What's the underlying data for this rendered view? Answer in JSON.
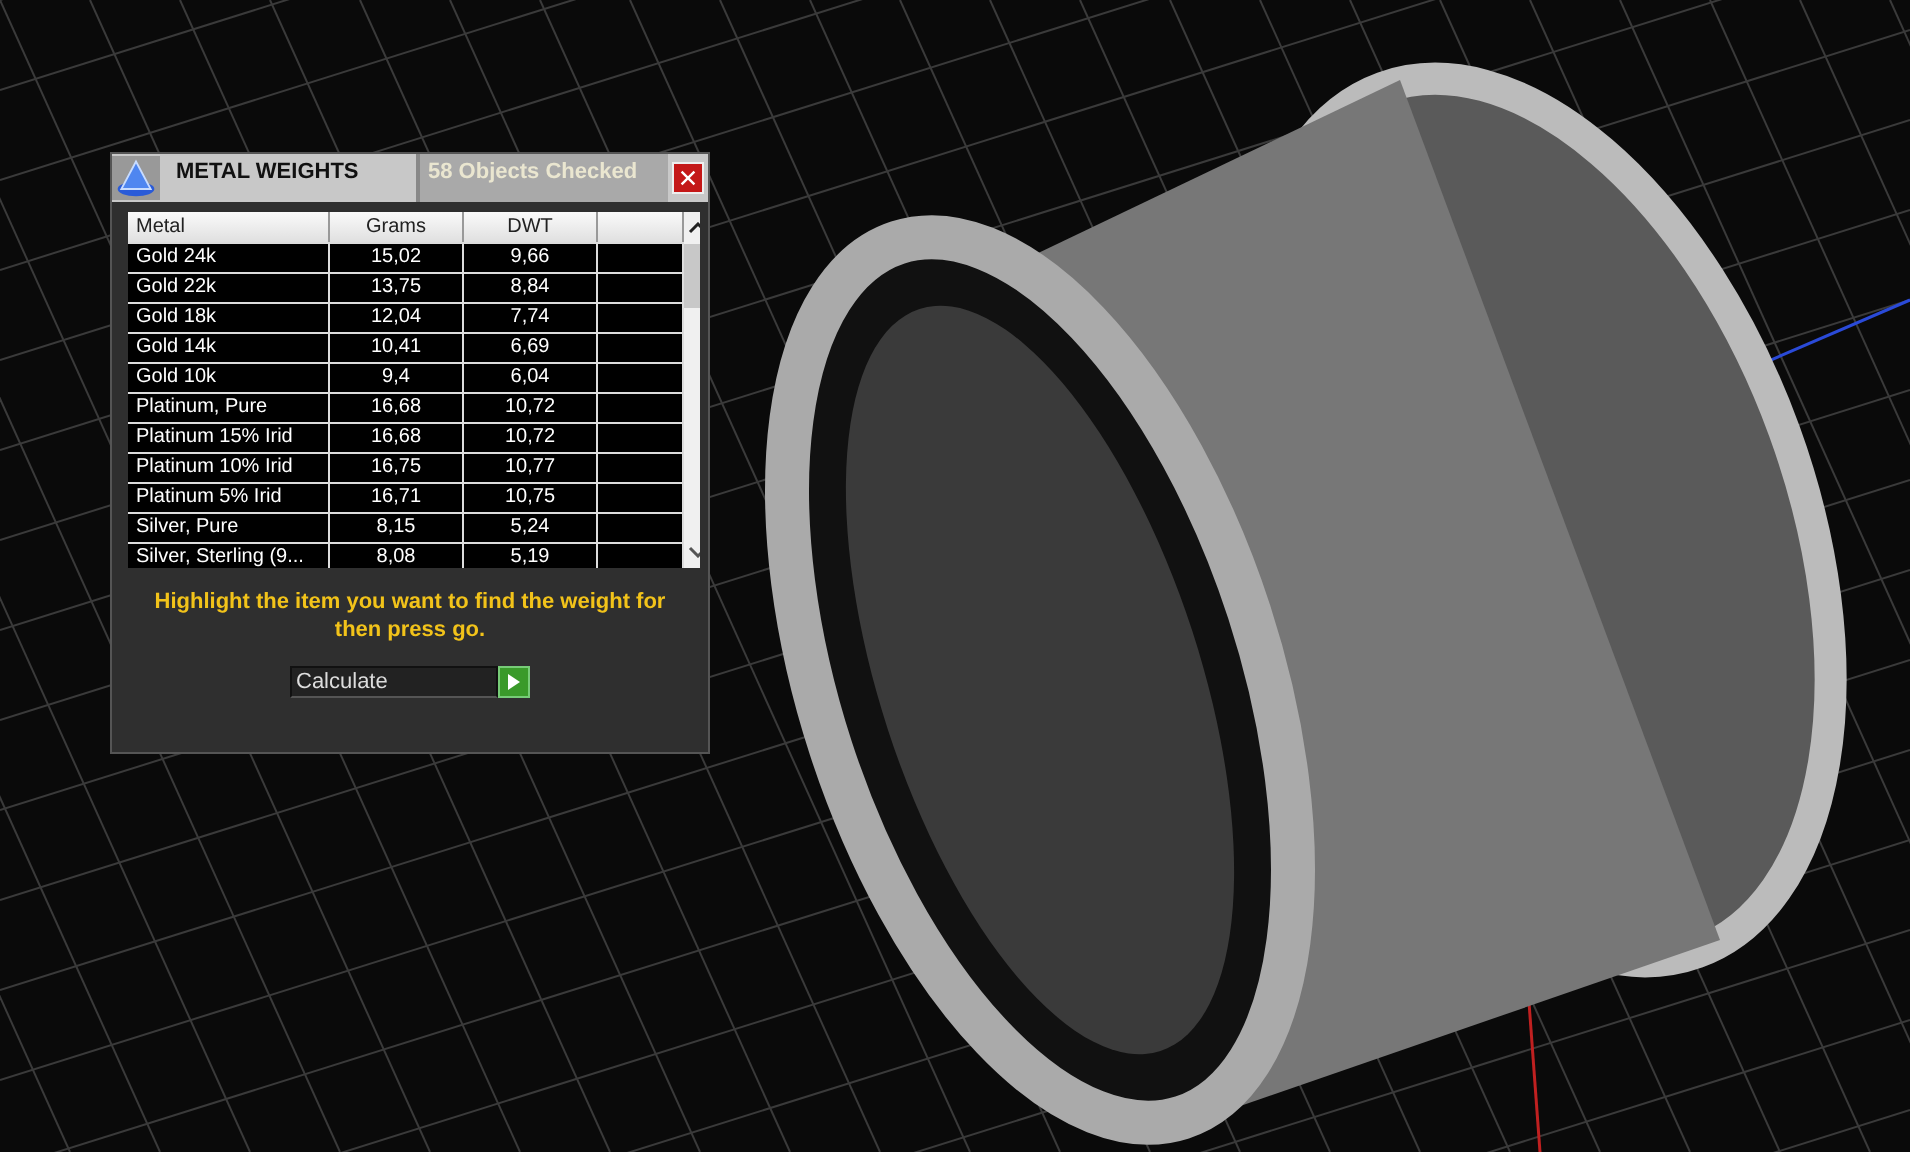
{
  "panel": {
    "title": "METAL WEIGHTS",
    "status": "58 Objects Checked",
    "table": {
      "columns": [
        "Metal",
        "Grams",
        "DWT"
      ],
      "rows": [
        {
          "metal": "Gold 24k",
          "grams": "15,02",
          "dwt": "9,66"
        },
        {
          "metal": "Gold 22k",
          "grams": "13,75",
          "dwt": "8,84"
        },
        {
          "metal": "Gold 18k",
          "grams": "12,04",
          "dwt": "7,74"
        },
        {
          "metal": "Gold 14k",
          "grams": "10,41",
          "dwt": "6,69"
        },
        {
          "metal": "Gold 10k",
          "grams": "9,4",
          "dwt": "6,04"
        },
        {
          "metal": "Platinum, Pure",
          "grams": "16,68",
          "dwt": "10,72"
        },
        {
          "metal": "Platinum 15% Irid",
          "grams": "16,68",
          "dwt": "10,72"
        },
        {
          "metal": "Platinum 10% Irid",
          "grams": "16,75",
          "dwt": "10,77"
        },
        {
          "metal": "Platinum 5% Irid",
          "grams": "16,71",
          "dwt": "10,75"
        },
        {
          "metal": "Silver, Pure",
          "grams": "8,15",
          "dwt": "5,24"
        },
        {
          "metal": "Silver, Sterling (9...",
          "grams": "8,08",
          "dwt": "5,19"
        }
      ]
    },
    "instruction": "Highlight the item you want to find the weight for then press go.",
    "action": {
      "value": "Calculate"
    }
  }
}
